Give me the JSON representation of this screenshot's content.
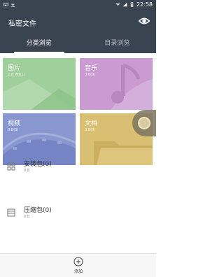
{
  "status_bar": {
    "time": "22:58"
  },
  "header": {
    "title": "私密文件",
    "eye_icon": "eye-icon"
  },
  "tabs": [
    {
      "label": "分类浏览",
      "active": true
    },
    {
      "label": "目录浏览",
      "active": false
    }
  ],
  "tiles": {
    "images": {
      "label": "图片",
      "size": "2.8 MB(1)",
      "color": "#9fcf9a"
    },
    "music": {
      "label": "音乐",
      "size": "0 B(0)",
      "color": "#c99bd0"
    },
    "video": {
      "label": "视频",
      "size": "0 B(0)",
      "color": "#8897cf"
    },
    "docs": {
      "label": "文档",
      "size": "0 B(0)",
      "color": "#d9bf72"
    }
  },
  "list": {
    "apk": {
      "title": "安装包(0)",
      "sub": "0 B",
      "icon": "grid-icon"
    },
    "zip": {
      "title": "压缩包(0)",
      "sub": "0 B",
      "icon": "archive-icon"
    }
  },
  "bottom_bar": {
    "add_label": "添加",
    "add_icon": "plus-circle-icon"
  },
  "colors": {
    "header_bg": "#3a4350"
  }
}
